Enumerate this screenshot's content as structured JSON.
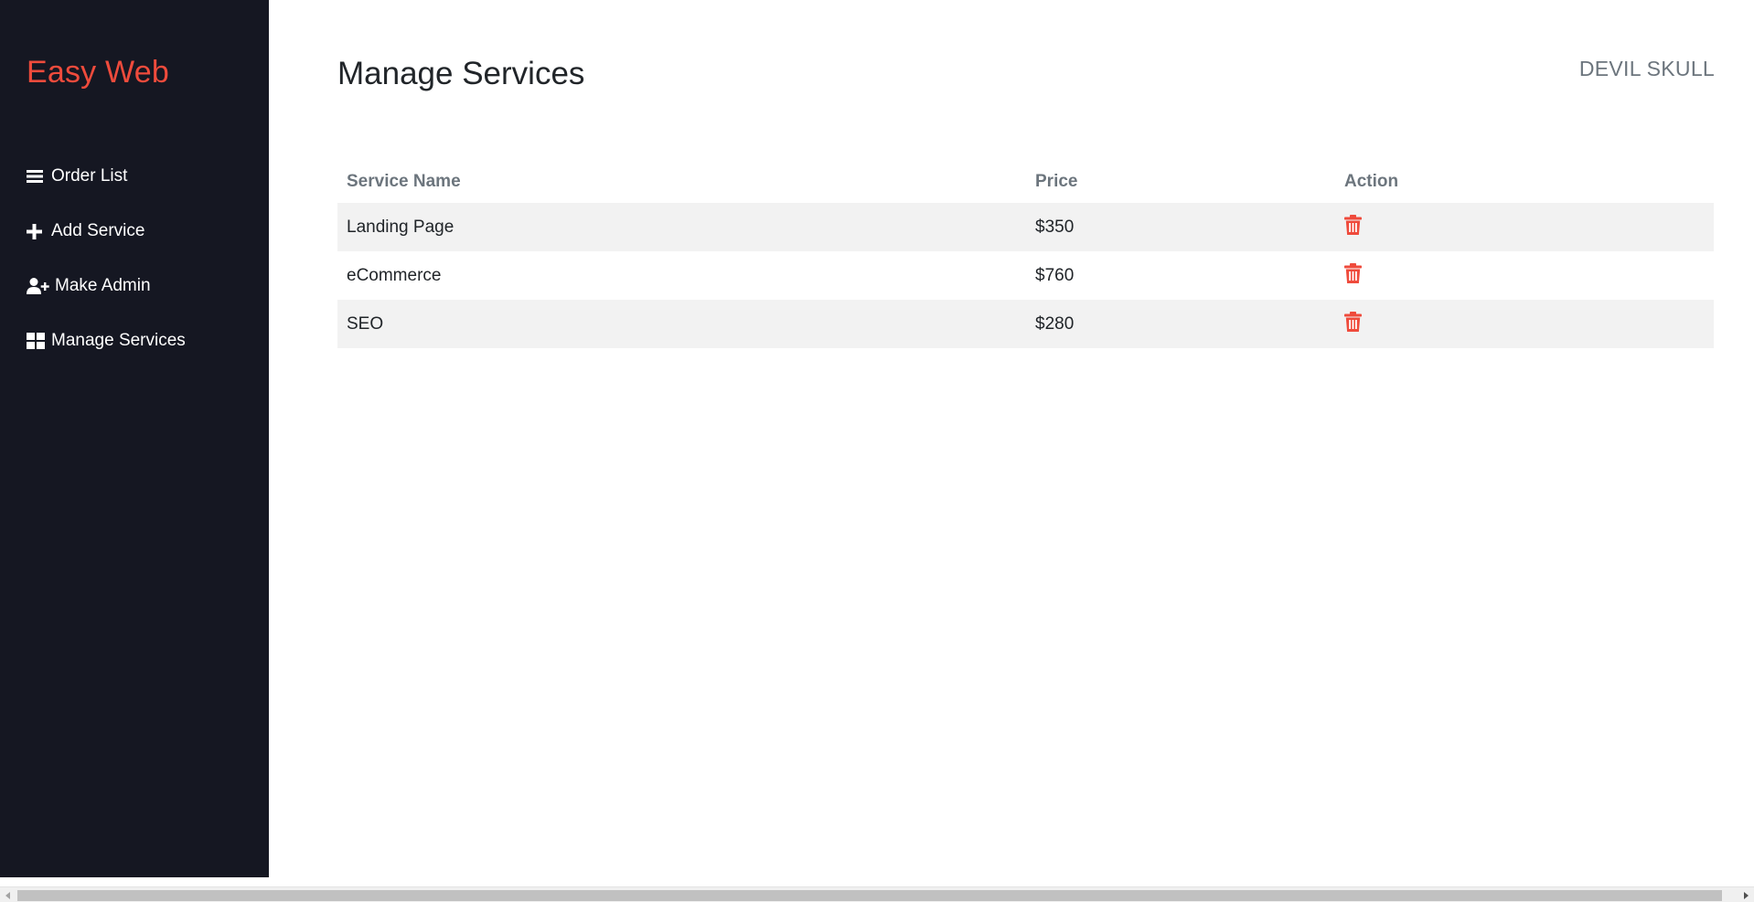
{
  "sidebar": {
    "brand": "Easy Web",
    "items": [
      {
        "label": "Order List",
        "icon": "list-icon"
      },
      {
        "label": "Add Service",
        "icon": "plus-icon"
      },
      {
        "label": "Make Admin",
        "icon": "user-plus-icon"
      },
      {
        "label": "Manage Services",
        "icon": "grid-icon"
      }
    ]
  },
  "header": {
    "title": "Manage Services",
    "user": "DEVIL SKULL"
  },
  "table": {
    "columns": [
      "Service Name",
      "Price",
      "Action"
    ],
    "rows": [
      {
        "name": "Landing Page",
        "price": "$350",
        "action_icon": "trash-icon"
      },
      {
        "name": "eCommerce",
        "price": "$760",
        "action_icon": "trash-icon"
      },
      {
        "name": "SEO",
        "price": "$280",
        "action_icon": "trash-icon"
      }
    ]
  },
  "colors": {
    "sidebar_bg": "#151722",
    "brand": "#ef4b3c",
    "delete_icon": "#ef4b3c",
    "row_stripe": "#f2f2f2",
    "header_text": "#6c757d"
  }
}
